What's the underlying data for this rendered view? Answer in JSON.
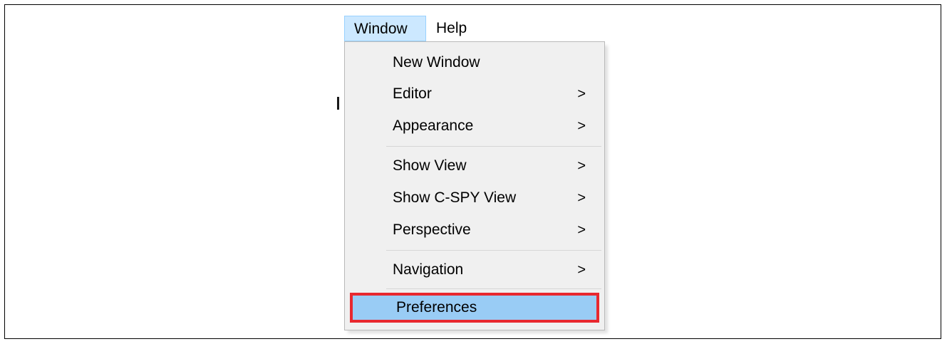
{
  "menubar": {
    "items": [
      {
        "label": "Window"
      },
      {
        "label": "Help"
      }
    ]
  },
  "window_menu": {
    "items": [
      {
        "label": "New Window",
        "submenu": false
      },
      {
        "label": "Editor",
        "submenu": true
      },
      {
        "label": "Appearance",
        "submenu": true
      },
      {
        "label": "Show View",
        "submenu": true
      },
      {
        "label": "Show C-SPY View",
        "submenu": true
      },
      {
        "label": "Perspective",
        "submenu": true
      },
      {
        "label": "Navigation",
        "submenu": true
      },
      {
        "label": "Preferences",
        "submenu": false
      }
    ],
    "submenu_arrow": ">",
    "selected": "Preferences"
  },
  "colors": {
    "hover_bg": "#cce8ff",
    "selected_bg": "#99ccf5",
    "highlight_border": "#e8282f",
    "menu_bg": "#f0f0f0"
  }
}
